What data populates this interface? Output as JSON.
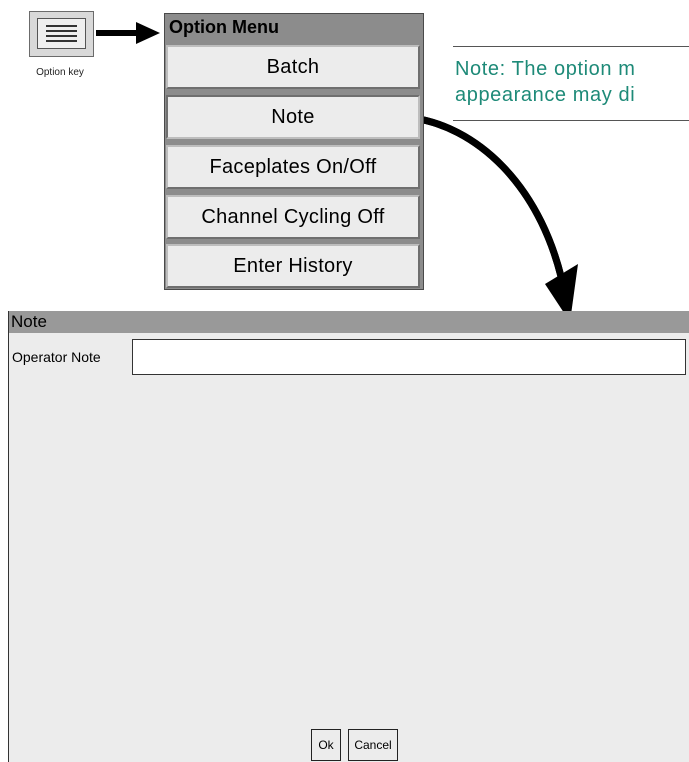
{
  "option_key": {
    "label": "Option key"
  },
  "menu": {
    "title": "Option Menu",
    "items": [
      "Batch",
      "Note",
      "Faceplates On/Off",
      "Channel Cycling Off",
      "Enter History"
    ]
  },
  "note": {
    "line1": "Note: The option m",
    "line2": "appearance may di"
  },
  "dialog": {
    "title": "Note",
    "field_label": "Operator Note",
    "field_value": "",
    "ok_label": "Ok",
    "cancel_label": "Cancel"
  }
}
